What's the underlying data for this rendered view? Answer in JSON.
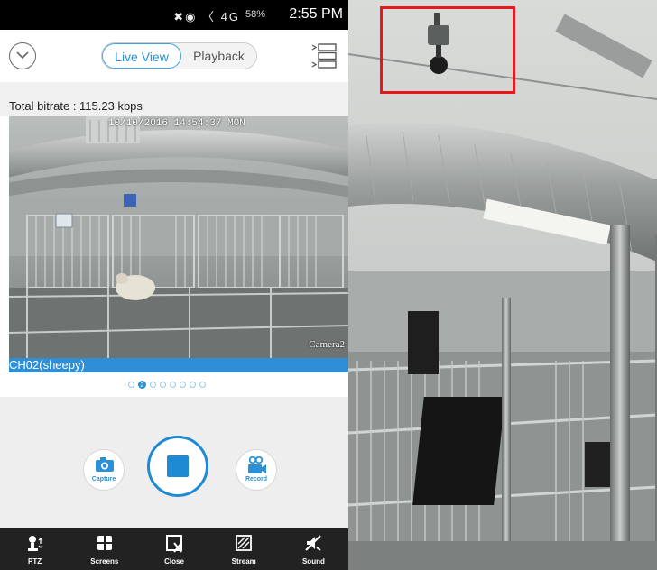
{
  "status_bar": {
    "signal_icons": "✖◉ 〈 4G",
    "battery": "58%",
    "time": "2:55 PM"
  },
  "header": {
    "back_icon": "chevron-down-icon",
    "live_view_label": "Live View",
    "playback_label": "Playback",
    "menu_icon": "channel-list-icon"
  },
  "bitrate": {
    "text": "Total bitrate : 115.23 kbps"
  },
  "video": {
    "timestamp": "10/10/2016 14:54:37 MON",
    "camera_label": "Camera2",
    "channel_label": "CH02(sheepy)"
  },
  "pager": {
    "total_pages": 8,
    "current_page": "2"
  },
  "controls": {
    "capture_label": "Capture",
    "record_label": "Record",
    "stop_icon": "stop-icon"
  },
  "toolbar": {
    "items": [
      {
        "label": "PTZ",
        "icon": "ptz-icon"
      },
      {
        "label": "Screens",
        "icon": "screens-icon"
      },
      {
        "label": "Close",
        "icon": "close-icon"
      },
      {
        "label": "Stream",
        "icon": "stream-icon"
      },
      {
        "label": "Sound",
        "icon": "sound-muted-icon"
      }
    ]
  },
  "colors": {
    "accent": "#2a91d6",
    "highlight": "#e8171c",
    "toolbar_bg": "#222222"
  }
}
